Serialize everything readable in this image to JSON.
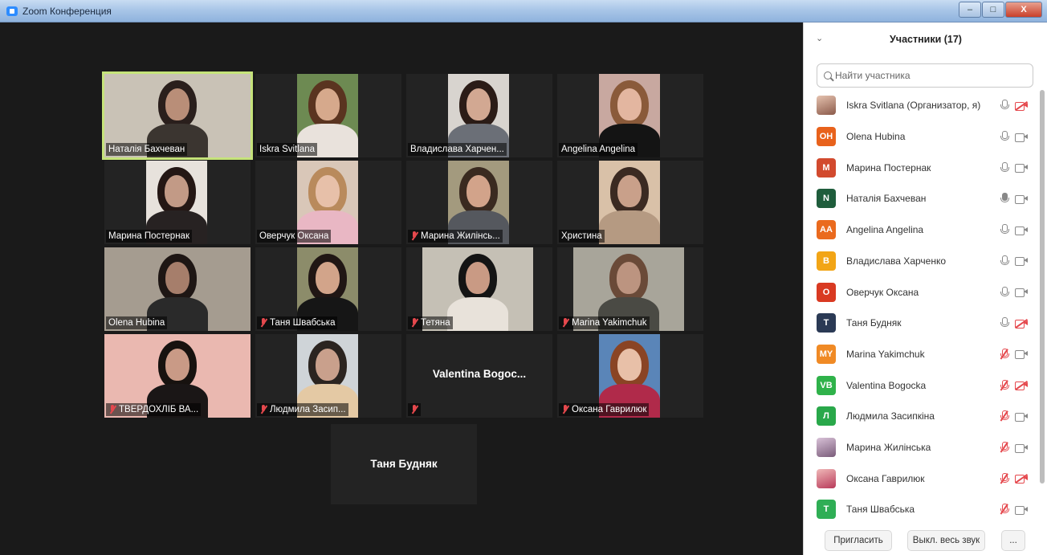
{
  "window": {
    "title": "Zoom Конференция",
    "min_label": "–",
    "max_label": "□",
    "close_label": "X"
  },
  "gallery": [
    {
      "name": "Наталія Бахчеван",
      "muted": false,
      "active": true,
      "video": true
    },
    {
      "name": "Iskra Svitlana",
      "muted": false,
      "active": false,
      "video": true
    },
    {
      "name": "Владислава Харчен...",
      "muted": false,
      "active": false,
      "video": true
    },
    {
      "name": "Angelina Angelina",
      "muted": false,
      "active": false,
      "video": true
    },
    {
      "name": "Марина Постернак",
      "muted": false,
      "active": false,
      "video": true
    },
    {
      "name": "Оверчук Оксана",
      "muted": false,
      "active": false,
      "video": true
    },
    {
      "name": "Марина Жилінсь...",
      "muted": true,
      "active": false,
      "video": true
    },
    {
      "name": "Христина",
      "muted": false,
      "active": false,
      "video": true
    },
    {
      "name": "Olena Hubina",
      "muted": false,
      "active": false,
      "video": true
    },
    {
      "name": "Таня Швабська",
      "muted": true,
      "active": false,
      "video": true
    },
    {
      "name": "Тетяна",
      "muted": true,
      "active": false,
      "video": true
    },
    {
      "name": "Marina Yakimchuk",
      "muted": true,
      "active": false,
      "video": true
    },
    {
      "name": "ТВЕРДОХЛІБ ВА...",
      "muted": true,
      "active": false,
      "video": true
    },
    {
      "name": "Людмила Засип...",
      "muted": true,
      "active": false,
      "video": true
    },
    {
      "name": "",
      "bigname": "Valentina  Bogoc...",
      "muted": true,
      "active": false,
      "video": false
    },
    {
      "name": "Оксана Гаврилюк",
      "muted": true,
      "active": false,
      "video": true
    },
    {
      "name": "",
      "bigname": "Таня Будняк",
      "muted": false,
      "active": false,
      "video": false
    }
  ],
  "participants_panel": {
    "title": "Участники (17)",
    "search_placeholder": "Найти участника",
    "participants": [
      {
        "name": "Iskra Svitlana (Организатор, я)",
        "initials": "",
        "avatar_color": "",
        "photo": "photo",
        "mic": "on",
        "cam": "off"
      },
      {
        "name": "Olena Hubina",
        "initials": "OH",
        "avatar_color": "#e8621c",
        "mic": "on",
        "cam": "on"
      },
      {
        "name": "Марина Постернак",
        "initials": "M",
        "avatar_color": "#d24a2e",
        "mic": "on",
        "cam": "on"
      },
      {
        "name": "Наталія Бахчеван",
        "initials": "N",
        "avatar_color": "#1f5d3c",
        "mic": "talking",
        "cam": "on"
      },
      {
        "name": "Angelina Angelina",
        "initials": "AA",
        "avatar_color": "#ea6a1e",
        "mic": "on",
        "cam": "on"
      },
      {
        "name": "Владислава Харченко",
        "initials": "B",
        "avatar_color": "#f2a516",
        "mic": "on",
        "cam": "on"
      },
      {
        "name": "Оверчук Оксана",
        "initials": "O",
        "avatar_color": "#d93a22",
        "mic": "on",
        "cam": "on"
      },
      {
        "name": "Таня Будняк",
        "initials": "T",
        "avatar_color": "#2b3a55",
        "mic": "on",
        "cam": "off"
      },
      {
        "name": "Marina Yakimchuk",
        "initials": "MY",
        "avatar_color": "#f08a25",
        "mic": "muted",
        "cam": "on"
      },
      {
        "name": "Valentina Bogocka",
        "initials": "VB",
        "avatar_color": "#2fb24a",
        "mic": "muted",
        "cam": "off"
      },
      {
        "name": "Людмила Засипкіна",
        "initials": "Л",
        "avatar_color": "#29a84a",
        "mic": "muted",
        "cam": "on"
      },
      {
        "name": "Марина Жилінська",
        "initials": "",
        "avatar_color": "",
        "photo": "photo2",
        "mic": "muted",
        "cam": "on"
      },
      {
        "name": "Оксана Гаврилюк",
        "initials": "",
        "avatar_color": "",
        "photo": "photo3",
        "mic": "muted",
        "cam": "off"
      },
      {
        "name": "Таня Швабська",
        "initials": "T",
        "avatar_color": "#2fae55",
        "mic": "muted",
        "cam": "on"
      }
    ],
    "footer": {
      "invite_label": "Пригласить",
      "mute_all_label": "Выкл. весь звук",
      "more_label": "..."
    }
  }
}
